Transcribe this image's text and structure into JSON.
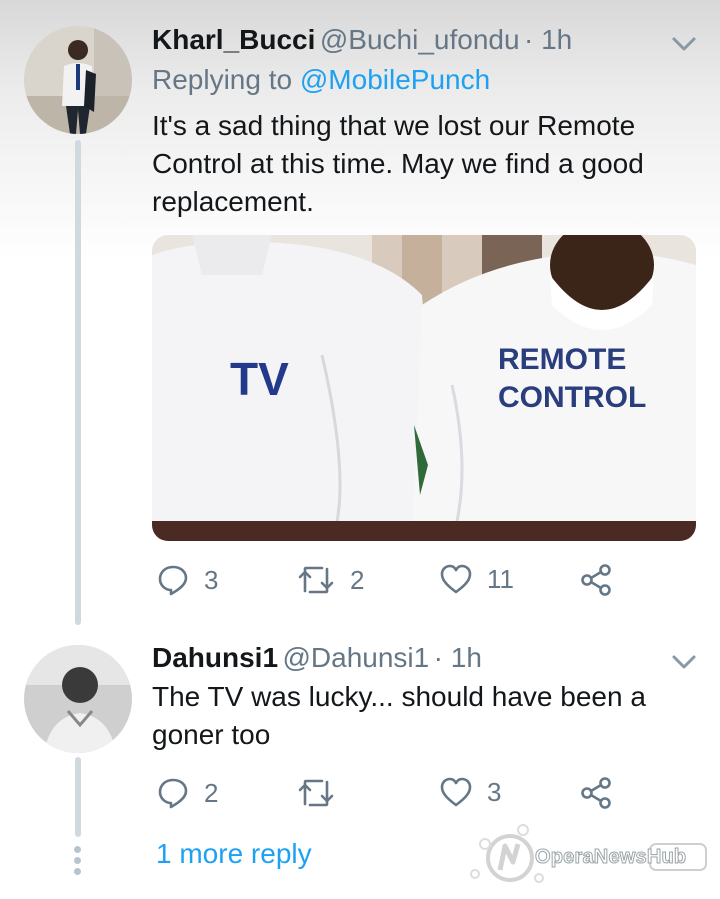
{
  "tweet1": {
    "display_name": "Kharl_Bucci",
    "handle": "@Buchi_ufondu",
    "time": "· 1h",
    "replying_prefix": "Replying to",
    "replying_handle": "@MobilePunch",
    "text": "It's a sad thing that we lost our Remote Control  at this time. May we find a good replacement.",
    "media": {
      "left_shirt_label": "TV",
      "right_shirt_label_line1": "REMOTE",
      "right_shirt_label_line2": "CONTROL"
    },
    "replies": "3",
    "retweets": "2",
    "likes": "11"
  },
  "tweet2": {
    "display_name": "Dahunsi1",
    "handle": "@Dahunsi1",
    "time": "· 1h",
    "text": "The TV was lucky... should have been a goner too",
    "replies": "2",
    "retweets": "",
    "likes": "3"
  },
  "thread": {
    "more_replies_label": "1 more reply"
  },
  "watermark": {
    "text": "OperaNewsHub"
  },
  "colors": {
    "link": "#1da1f2",
    "muted": "#657786",
    "text": "#14171a"
  }
}
